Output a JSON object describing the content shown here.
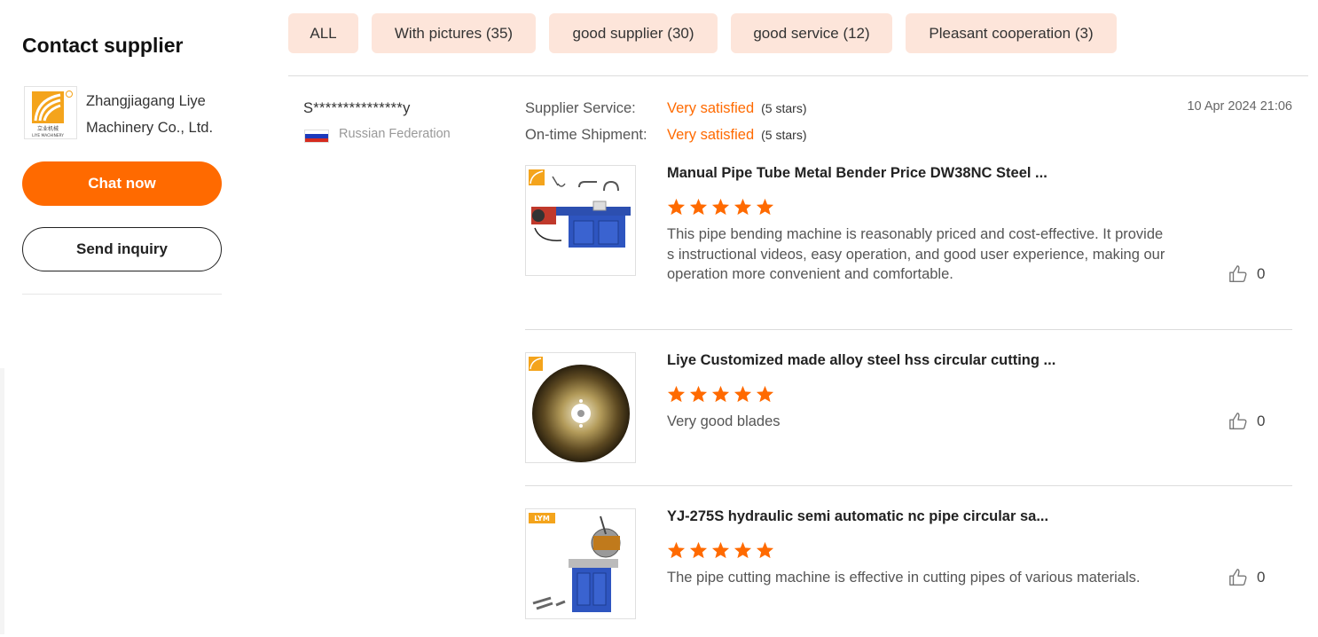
{
  "sidebar": {
    "title": "Contact supplier",
    "supplier_name": "Zhangjiagang Liye Machinery Co., Ltd.",
    "logo_text": "LIYE MACHINERY",
    "logo_cn": "立业机械",
    "chat_label": "Chat now",
    "inquiry_label": "Send inquiry"
  },
  "filters": [
    {
      "label": "ALL"
    },
    {
      "label": "With pictures (35)"
    },
    {
      "label": "good supplier (30)"
    },
    {
      "label": "good service (12)"
    },
    {
      "label": "Pleasant cooperation (3)"
    }
  ],
  "reviewer": {
    "name": "S***************y",
    "country": "Russian Federation",
    "date": "10 Apr 2024 21:06"
  },
  "ratings": [
    {
      "label": "Supplier Service:",
      "value": "Very satisfied",
      "stars": "(5 stars)"
    },
    {
      "label": "On-time Shipment:",
      "value": "Very satisfied",
      "stars": "(5 stars)"
    }
  ],
  "items": [
    {
      "title": "Manual Pipe Tube Metal Bender Price DW38NC Steel ...",
      "rating": 5,
      "text": "This pipe bending machine is reasonably priced and cost-effective. It provides instructional videos, easy operation, and good user experience, making our operation more convenient and comfortable.",
      "likes": "0",
      "image": "pipe-bender-machine"
    },
    {
      "title": "Liye Customized made alloy steel hss circular cutting ...",
      "rating": 5,
      "text": "Very good blades",
      "likes": "0",
      "image": "circular-saw-blade"
    },
    {
      "title": "YJ-275S hydraulic semi automatic nc pipe circular sa...",
      "rating": 5,
      "text": "The pipe cutting machine is effective in cutting pipes of various materials.",
      "likes": "0",
      "image": "pipe-cutting-machine"
    }
  ],
  "colors": {
    "accent": "#ff6a00",
    "chip_bg": "#fde5da",
    "star": "#ff6a00"
  }
}
